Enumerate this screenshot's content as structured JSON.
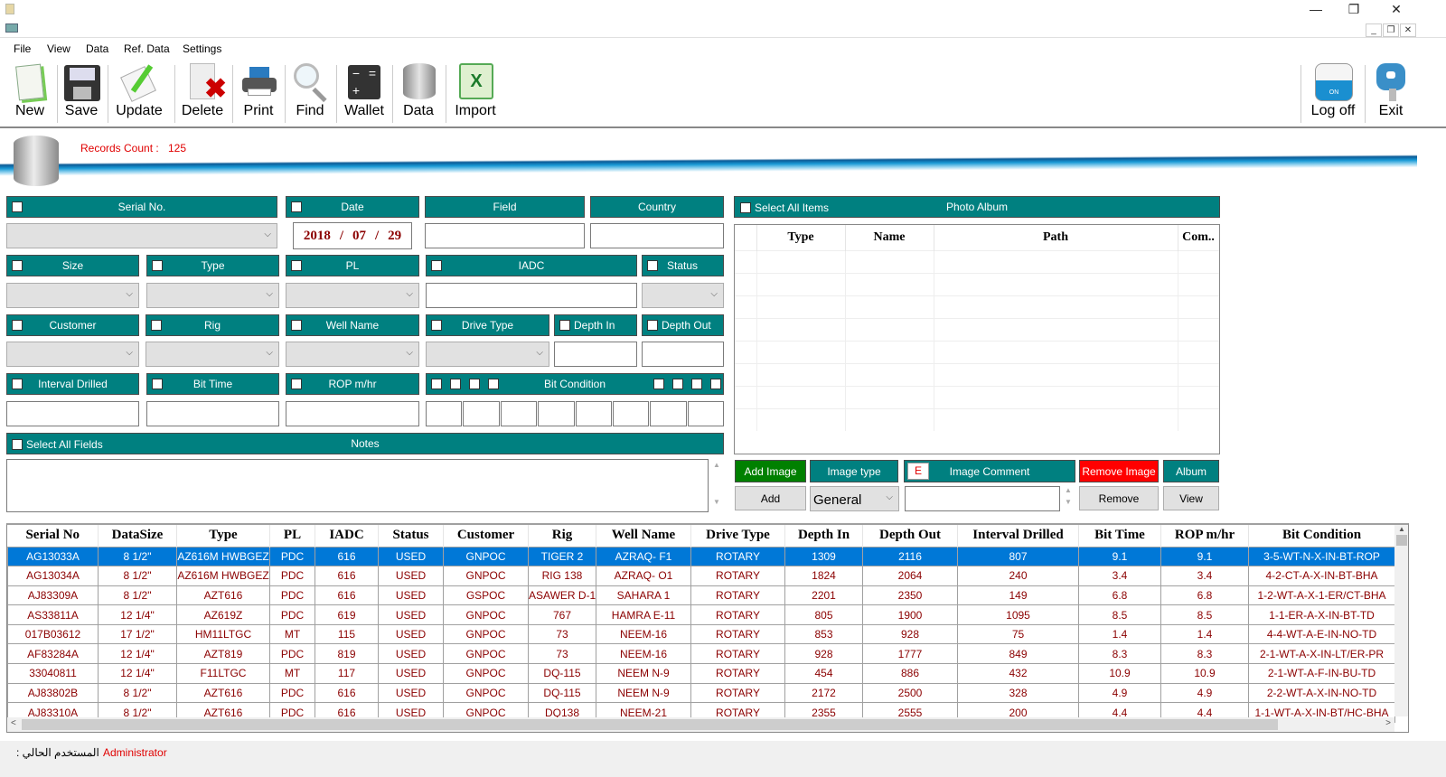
{
  "window": {
    "minimize": "—",
    "restore": "❐",
    "close": "✕",
    "mdi_minimize": "_",
    "mdi_restore": "❐",
    "mdi_close": "✕"
  },
  "menu": [
    "File",
    "View",
    "Data",
    "Ref. Data",
    "Settings"
  ],
  "toolbar": [
    {
      "label": "New",
      "icon": "new-document-icon"
    },
    {
      "label": "Save",
      "icon": "floppy-disk-icon"
    },
    {
      "label": "Update",
      "icon": "edit-pencil-icon"
    },
    {
      "label": "Delete",
      "icon": "delete-document-icon"
    },
    {
      "label": "Print",
      "icon": "printer-icon"
    },
    {
      "label": "Find",
      "icon": "magnifier-icon"
    },
    {
      "label": "Wallet",
      "icon": "calculator-icon"
    },
    {
      "label": "Data",
      "icon": "database-icon"
    },
    {
      "label": "Import",
      "icon": "excel-icon"
    }
  ],
  "toolbar_right": [
    {
      "label": "Log off",
      "icon": "toggle-switch-icon",
      "switch_text": "ON"
    },
    {
      "label": "Exit",
      "icon": "key-icon"
    }
  ],
  "records": {
    "label": "Records Count :",
    "value": "125"
  },
  "form": {
    "serial_no": "Serial No.",
    "date": "Date",
    "field": "Field",
    "country": "Country",
    "date_value": {
      "year": "2018",
      "month": "07",
      "day": "29",
      "sep": "/"
    },
    "size": "Size",
    "type": "Type",
    "pl": "PL",
    "iadc": "IADC",
    "status": "Status",
    "customer": "Customer",
    "rig": "Rig",
    "well_name": "Well Name",
    "drive_type": "Drive Type",
    "depth_in": "Depth In",
    "depth_out": "Depth Out",
    "interval_drilled": "Interval Drilled",
    "bit_time": "Bit Time",
    "rop": "ROP m/hr",
    "bit_condition": "Bit Condition",
    "select_all_fields": "Select All Fields",
    "notes": "Notes",
    "chevron": "⌵"
  },
  "photo_album": {
    "select_all": "Select All Items",
    "title": "Photo Album",
    "columns": [
      "Type",
      "Name",
      "Path",
      "Com.."
    ],
    "add_image": "Add Image",
    "image_type": "Image type",
    "e_label": "E",
    "image_comment": "Image Comment",
    "remove_image": "Remove Image",
    "album": "Album",
    "add": "Add",
    "image_type_value": "General",
    "remove": "Remove",
    "view": "View"
  },
  "grid": {
    "columns": [
      "Serial No",
      "DataSize",
      "Type",
      "PL",
      "IADC",
      "Status",
      "Customer",
      "Rig",
      "Well Name",
      "Drive Type",
      "Depth In",
      "Depth Out",
      "Interval Drilled",
      "Bit Time",
      "ROP m/hr",
      "Bit Condition"
    ],
    "rows": [
      [
        "AG13033A",
        "8 1/2\"",
        "AZ616M HWBGEZ",
        "PDC",
        "616",
        "USED",
        "GNPOC",
        "TIGER 2",
        "AZRAQ- F1",
        "ROTARY",
        "1309",
        "2116",
        "807",
        "9.1",
        "9.1",
        "3-5-WT-N-X-IN-BT-ROP"
      ],
      [
        "AG13034A",
        "8 1/2\"",
        "AZ616M HWBGEZ",
        "PDC",
        "616",
        "USED",
        "GNPOC",
        "RIG 138",
        "AZRAQ- O1",
        "ROTARY",
        "1824",
        "2064",
        "240",
        "3.4",
        "3.4",
        "4-2-CT-A-X-IN-BT-BHA"
      ],
      [
        "AJ83309A",
        "8 1/2\"",
        "AZT616",
        "PDC",
        "616",
        "USED",
        "GSPOC",
        "ASAWER D-1",
        "SAHARA 1",
        "ROTARY",
        "2201",
        "2350",
        "149",
        "6.8",
        "6.8",
        "1-2-WT-A-X-1-ER/CT-BHA"
      ],
      [
        "AS33811A",
        "12 1/4\"",
        "AZ619Z",
        "PDC",
        "619",
        "USED",
        "GNPOC",
        "767",
        "HAMRA E-11",
        "ROTARY",
        "805",
        "1900",
        "1095",
        "8.5",
        "8.5",
        "1-1-ER-A-X-IN-BT-TD"
      ],
      [
        "017B03612",
        "17 1/2\"",
        "HM11LTGC",
        "MT",
        "115",
        "USED",
        "GNPOC",
        "73",
        "NEEM-16",
        "ROTARY",
        "853",
        "928",
        "75",
        "1.4",
        "1.4",
        "4-4-WT-A-E-IN-NO-TD"
      ],
      [
        "AF83284A",
        "12 1/4\"",
        "AZT819",
        "PDC",
        "819",
        "USED",
        "GNPOC",
        "73",
        "NEEM-16",
        "ROTARY",
        "928",
        "1777",
        "849",
        "8.3",
        "8.3",
        "2-1-WT-A-X-IN-LT/ER-PR"
      ],
      [
        "33040811",
        "12 1/4\"",
        "F11LTGC",
        "MT",
        "117",
        "USED",
        "GNPOC",
        "DQ-115",
        "NEEM N-9",
        "ROTARY",
        "454",
        "886",
        "432",
        "10.9",
        "10.9",
        "2-1-WT-A-F-IN-BU-TD"
      ],
      [
        "AJ83802B",
        "8 1/2\"",
        "AZT616",
        "PDC",
        "616",
        "USED",
        "GNPOC",
        "DQ-115",
        "NEEM N-9",
        "ROTARY",
        "2172",
        "2500",
        "328",
        "4.9",
        "4.9",
        "2-2-WT-A-X-IN-NO-TD"
      ],
      [
        "AJ83310A",
        "8 1/2\"",
        "AZT616",
        "PDC",
        "616",
        "USED",
        "GNPOC",
        "DQ138",
        "NEEM-21",
        "ROTARY",
        "2355",
        "2555",
        "200",
        "4.4",
        "4.4",
        "1-1-WT-A-X-IN-BT/HC-BHA"
      ]
    ]
  },
  "status_bar": {
    "label": "المستخدم الحالي :",
    "user": "Administrator"
  },
  "colors": {
    "teal": "#008080",
    "selection": "#0078d7",
    "cell_text": "#8b0000",
    "add_green": "#008000",
    "remove_red": "#ff0000",
    "records_red": "#e00000"
  }
}
